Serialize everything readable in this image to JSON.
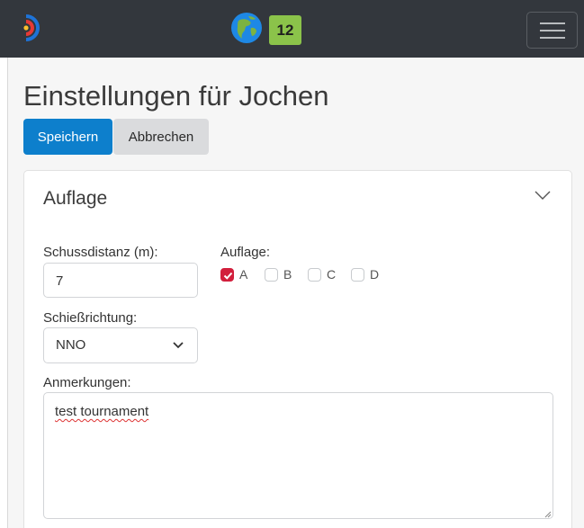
{
  "navbar": {
    "badge_count": "12",
    "logo_icon": "archery-target-logo-icon",
    "globe_icon": "globe-icon",
    "menu_icon": "hamburger-menu-icon"
  },
  "page": {
    "title": "Einstellungen für Jochen"
  },
  "actions": {
    "save_label": "Speichern",
    "cancel_label": "Abbrechen"
  },
  "section": {
    "title": "Auflage",
    "toggle_icon": "chevron-down-icon"
  },
  "form": {
    "distance_label": "Schussdistanz (m):",
    "distance_value": "7",
    "target_label": "Auflage:",
    "target_options": [
      {
        "label": "A",
        "checked": true
      },
      {
        "label": "B",
        "checked": false
      },
      {
        "label": "C",
        "checked": false
      },
      {
        "label": "D",
        "checked": false
      }
    ],
    "direction_label": "Schießrichtung:",
    "direction_value": "NNO",
    "notes_label": "Anmerkungen:",
    "notes_value": "test tournament"
  },
  "colors": {
    "navbar": "#33373d",
    "primary": "#0d7fcc",
    "badge": "#8bc34a",
    "checkbox_checked": "#d21f3c"
  }
}
